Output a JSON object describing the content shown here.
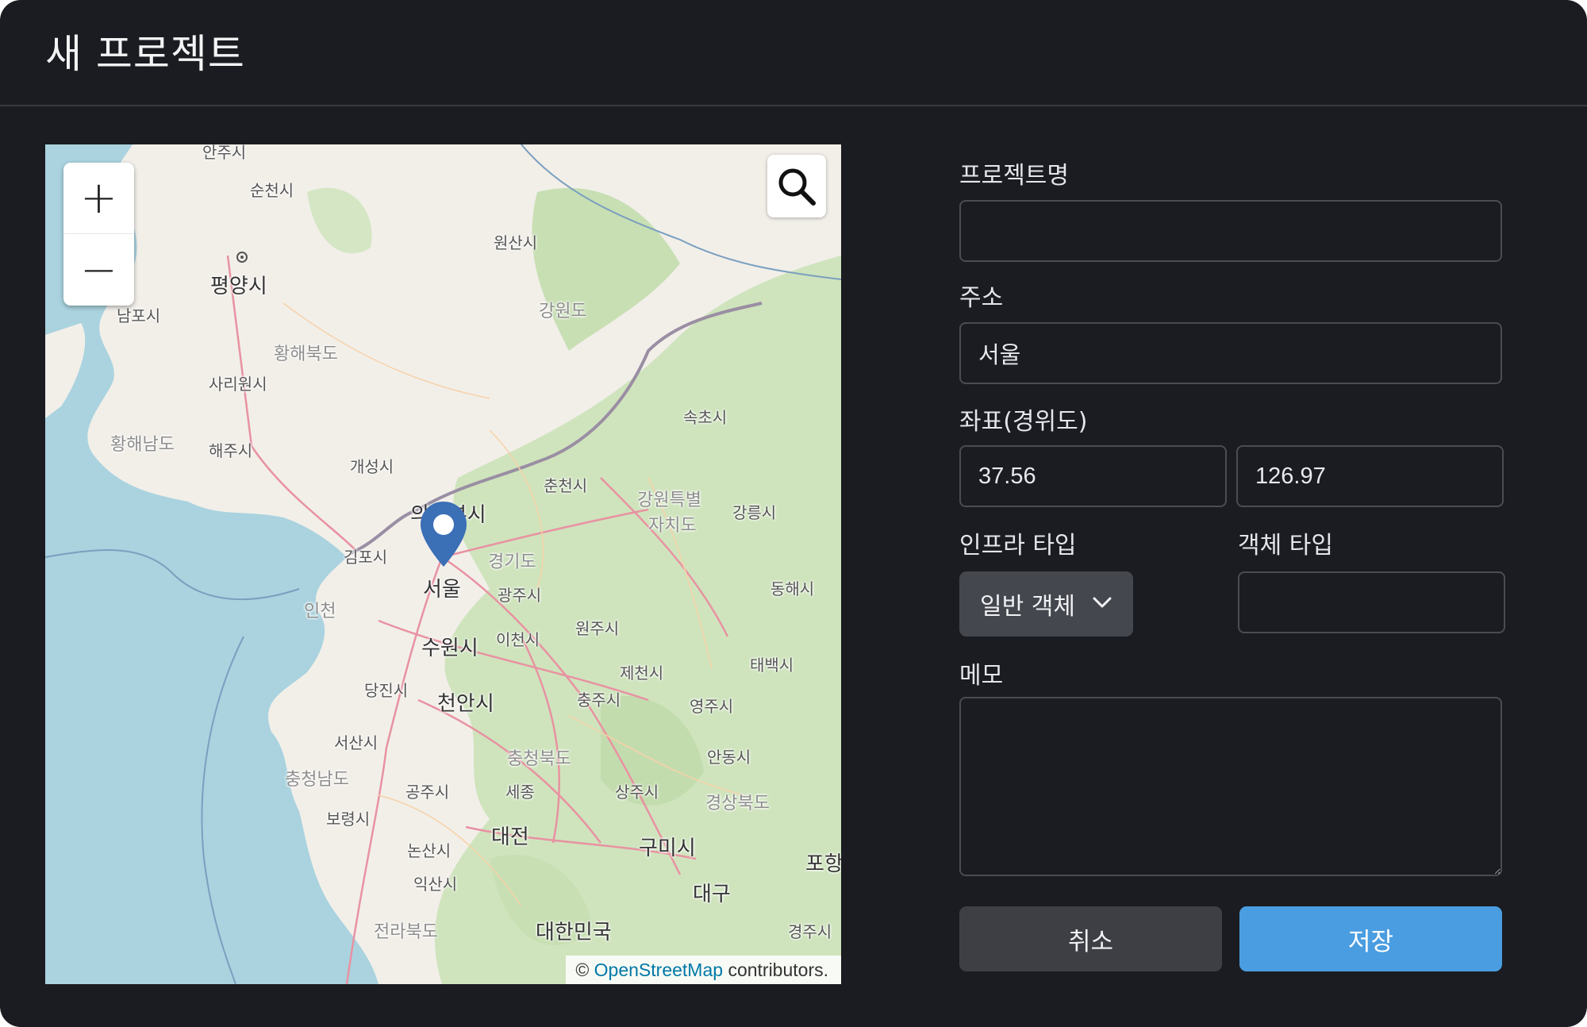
{
  "dialog": {
    "title": "새 프로젝트"
  },
  "map": {
    "zoom_in_label": "+",
    "zoom_out_label": "−",
    "search_icon": "search-icon",
    "marker_icon": "map-pin-icon",
    "marker_color": "#3b6fb6",
    "attribution": {
      "symbol": "©",
      "link": "OpenStreetMap",
      "suffix": "contributors."
    },
    "labels": {
      "anju": "안주시",
      "suncheon": "순천시",
      "pyongyang": "평양시",
      "nampo": "남포시",
      "wonsan": "원산시",
      "gangwon_n": "강원도",
      "hwanghae_n": "황해북도",
      "sariwon": "사리원시",
      "hwanghae_s": "황해남도",
      "haeju": "해주시",
      "kaesong": "개성시",
      "sokcho": "속초시",
      "chuncheon": "춘천시",
      "uijeongbu": "의정부시",
      "gangwon_special_1": "강원특별",
      "gangwon_special_2": "자치도",
      "gangneung": "강릉시",
      "gimpo": "김포시",
      "gyeonggi": "경기도",
      "seoul": "서울",
      "gwangju_g": "광주시",
      "donghae": "동해시",
      "incheon": "인천",
      "wonju": "원주시",
      "suwon": "수원시",
      "icheon": "이천시",
      "jecheon": "제천시",
      "taebaek": "태백시",
      "dangjin": "당진시",
      "cheonan": "천안시",
      "chungju": "충주시",
      "yeongju": "영주시",
      "seosan": "서산시",
      "chungbuk": "충청북도",
      "andong": "안동시",
      "chungnam": "충청남도",
      "gongju": "공주시",
      "sejong": "세종",
      "sangju": "상주시",
      "gyeongbuk": "경상북도",
      "boryeong": "보령시",
      "daejeon": "대전",
      "pohang": "포항",
      "nonsan": "논산시",
      "gumi": "구미시",
      "iksan": "익산시",
      "daegu": "대구",
      "jeonbuk": "전라북도",
      "korea": "대한민국",
      "gyeongju": "경주시"
    }
  },
  "form": {
    "project_name": {
      "label": "프로젝트명",
      "value": "",
      "placeholder": ""
    },
    "address": {
      "label": "주소",
      "value": "서울"
    },
    "coords": {
      "label": "좌표(경위도)",
      "lat": "37.56",
      "lng": "126.97"
    },
    "infra_type": {
      "label": "인프라 타입",
      "selected": "일반 객체"
    },
    "object_type": {
      "label": "객체 타입",
      "value": ""
    },
    "memo": {
      "label": "메모",
      "value": ""
    }
  },
  "actions": {
    "cancel_label": "취소",
    "save_label": "저장"
  },
  "colors": {
    "background": "#1b1c21",
    "primary": "#4a9de0",
    "secondary_button": "#3d3f45",
    "select_bg": "#45474f",
    "map_water": "#aad3df",
    "map_land": "#f2efe9",
    "map_forest": "#c8dfb4"
  }
}
